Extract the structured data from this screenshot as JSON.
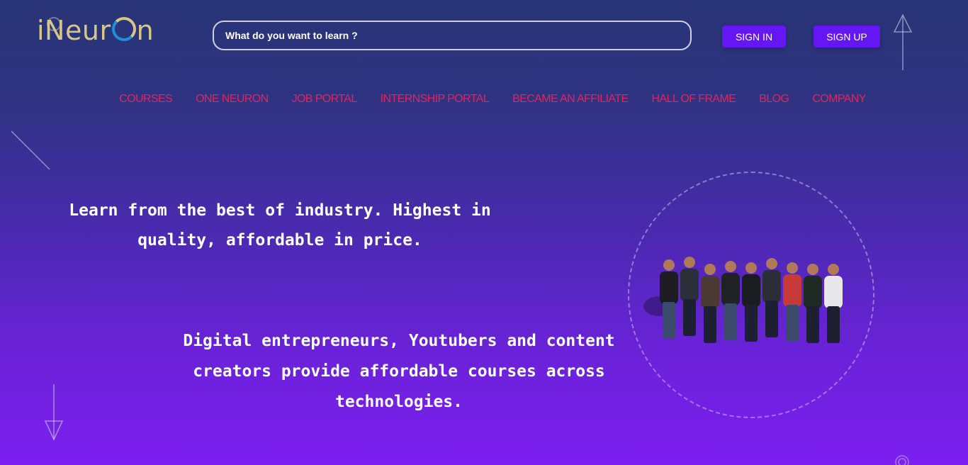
{
  "header": {
    "logo_text_start": "iNeur",
    "logo_text_end": "n",
    "search_placeholder": "What do you want to learn ?",
    "signin_label": "SIGN IN",
    "signup_label": "SIGN UP"
  },
  "nav": {
    "items": [
      {
        "label": "COURSES"
      },
      {
        "label": "ONE NEURON"
      },
      {
        "label": "JOB PORTAL"
      },
      {
        "label": "INTERNSHIP PORTAL"
      },
      {
        "label": "BECAME AN AFFILIATE"
      },
      {
        "label": "HALL OF FRAME"
      },
      {
        "label": "BLOG"
      },
      {
        "label": "COMPANY"
      }
    ]
  },
  "hero": {
    "headline": "Learn from the best of industry. Highest in quality, affordable in price.",
    "subtext": "Digital entrepreneurs, Youtubers and content creators provide affordable courses across technologies."
  },
  "colors": {
    "nav_link": "#e0245e",
    "button_bg": "#6417f2",
    "logo_gold": "#d8c58a",
    "logo_blue": "#1f8fd8"
  },
  "icons": [
    "up-arrow-icon",
    "down-arrow-icon",
    "logo-ring-icon",
    "team-photo"
  ]
}
